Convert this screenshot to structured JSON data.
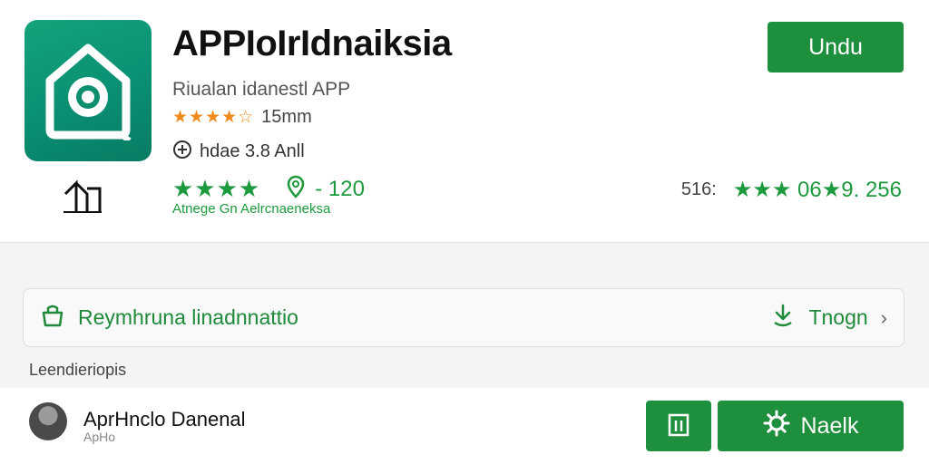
{
  "app": {
    "title": "APPIoIrIdnaiksia",
    "subtitle": "Riualan idanestl APP",
    "rating_stars": "★★★★☆",
    "rating_text": "15mm",
    "info_text": "hdae 3.8 Anll",
    "green_stars": "★★★★",
    "green_count": "- 120",
    "green_caption": "Atnege Gn Aelrcnaeneksa"
  },
  "stats": {
    "number": "516:",
    "green_text": "★★★ 06★9. 256"
  },
  "install_button": {
    "label": "Undu"
  },
  "info_bar": {
    "label": "Reymhruna linadnnattio",
    "action": "Tnogn"
  },
  "section": {
    "label": "Leendieriopis"
  },
  "developer": {
    "name": "AprHnclo Danenal",
    "sub": "ApHo",
    "button_label": "Naelk"
  },
  "colors": {
    "brand_green": "#1e8f3c",
    "icon_teal": "#0a8f72",
    "star_orange": "#f08a1c"
  },
  "icons": [
    "app-logo-icon",
    "share-icon",
    "plus-circle-icon",
    "location-icon",
    "bag-icon",
    "download-icon",
    "chevron-right-icon",
    "grid-icon",
    "gear-icon"
  ]
}
